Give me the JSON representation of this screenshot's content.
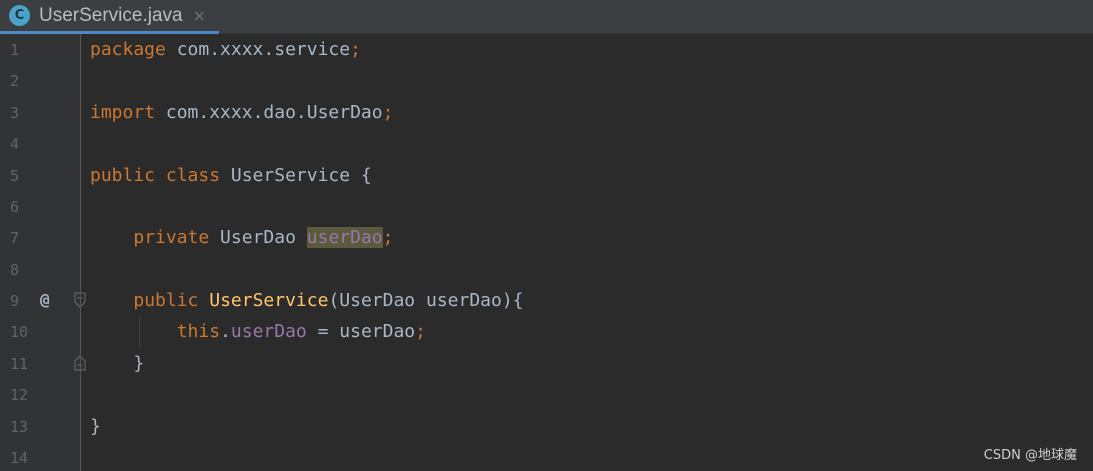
{
  "tab": {
    "icon_letter": "C",
    "title": "UserService.java",
    "close": "×"
  },
  "gutter": {
    "line_numbers": [
      "1",
      "2",
      "3",
      "4",
      "5",
      "6",
      "7",
      "8",
      "9",
      "10",
      "11",
      "12",
      "13",
      "14"
    ],
    "marker_line9": "@"
  },
  "code": {
    "l1": {
      "kw": "package",
      "rest": " com.xxxx.service",
      "semi": ";"
    },
    "l3": {
      "kw": "import",
      "rest": " com.xxxx.dao.UserDao",
      "semi": ";"
    },
    "l5": {
      "kw": "public class",
      "rest": " UserService {"
    },
    "l7": {
      "indent": "    ",
      "kw": "private",
      "type": " UserDao ",
      "field": "userDao",
      "semi": ";"
    },
    "l9": {
      "indent": "    ",
      "kw": "public",
      "sp": " ",
      "fn": "UserService",
      "rest": "(UserDao userDao){"
    },
    "l10": {
      "indent": "        ",
      "kw": "this",
      "dot": ".",
      "field": "userDao",
      "rest": " = userDao",
      "semi": ";"
    },
    "l11": {
      "indent": "    ",
      "rest": "}"
    },
    "l13": {
      "rest": "}"
    }
  },
  "watermark": "CSDN @地球魔",
  "colors": {
    "keyword": "#cc7832",
    "method": "#ffc66d",
    "field": "#9876aa",
    "text": "#a9b7c6",
    "background": "#2b2b2b"
  }
}
